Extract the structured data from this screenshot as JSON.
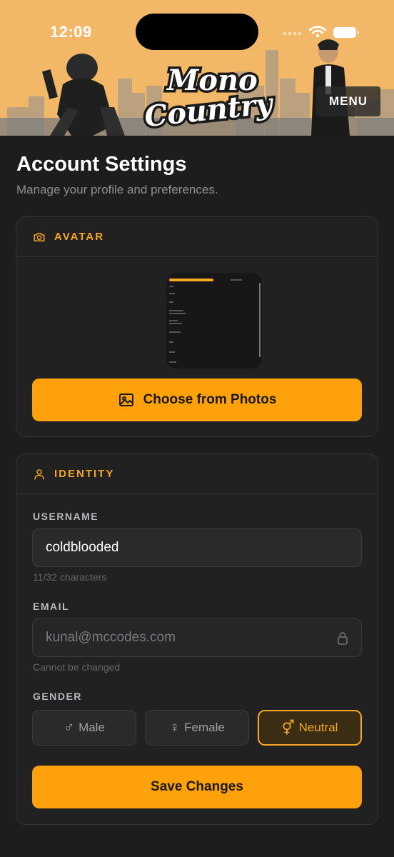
{
  "status": {
    "time": "12:09"
  },
  "header": {
    "logo_line1": "Mono",
    "logo_line2": "Country",
    "menu_label": "MENU"
  },
  "page": {
    "title": "Account Settings",
    "subtitle": "Manage your profile and preferences."
  },
  "avatar": {
    "section_title": "AVATAR",
    "choose_button": "Choose from Photos"
  },
  "identity": {
    "section_title": "IDENTITY",
    "username_label": "USERNAME",
    "username_value": "coldblooded",
    "username_hint": "11/32 characters",
    "email_label": "EMAIL",
    "email_value": "kunal@mccodes.com",
    "email_hint": "Cannot be changed",
    "gender_label": "GENDER",
    "gender_options": [
      {
        "label": "Male",
        "symbol": "♂"
      },
      {
        "label": "Female",
        "symbol": "♀"
      },
      {
        "label": "Neutral",
        "symbol": "⚥"
      }
    ],
    "selected_gender": "Neutral",
    "save_button": "Save Changes"
  },
  "colors": {
    "accent": "#ffa10a",
    "background": "#1d1d1d",
    "card": "#212121",
    "header": "#f3b867"
  },
  "icons": [
    "camera-icon",
    "image-icon",
    "user-icon",
    "lock-icon",
    "wifi-icon",
    "battery-icon",
    "signal-icon"
  ]
}
